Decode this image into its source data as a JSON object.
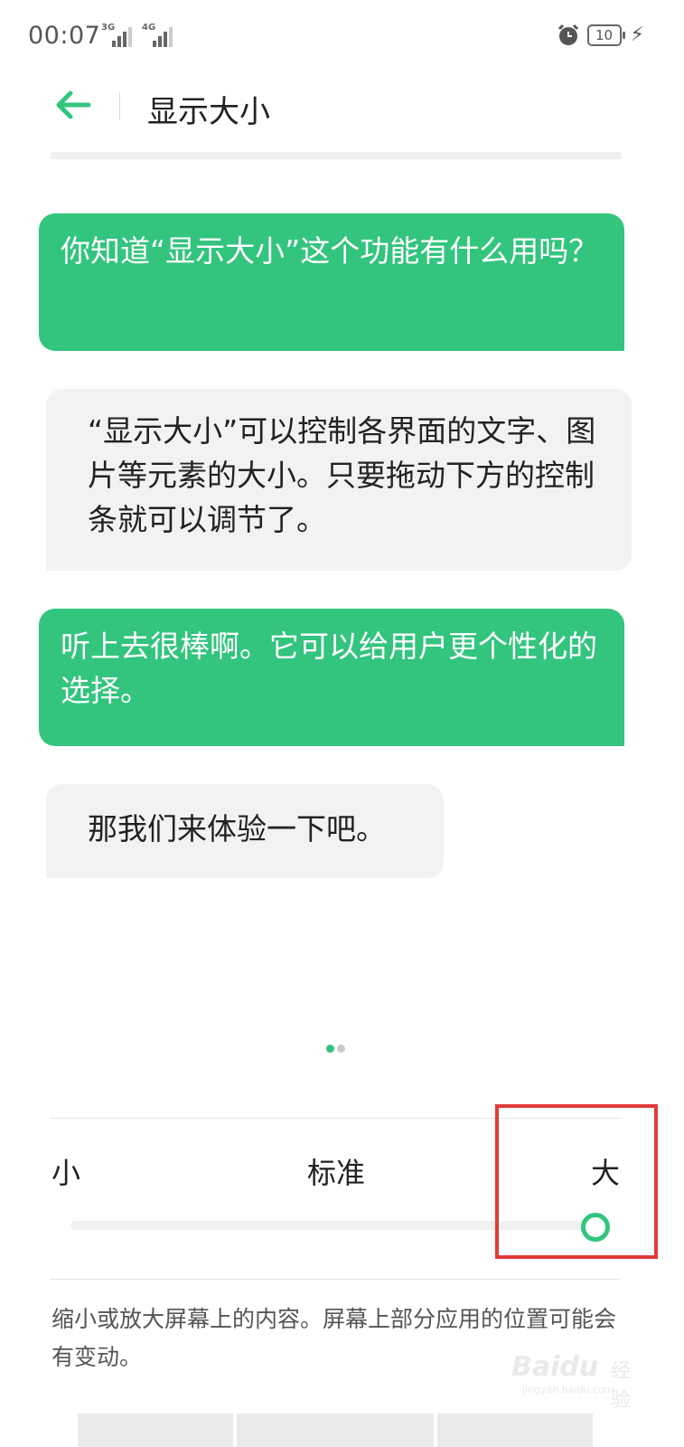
{
  "status_bar": {
    "time": "00:07",
    "signal_1_type": "3G",
    "signal_2_type": "4G",
    "battery_level": "10",
    "icons": [
      "alarm-icon",
      "battery-icon",
      "charging-icon"
    ]
  },
  "header": {
    "title": "显示大小",
    "back_icon": "back-arrow-icon"
  },
  "chat": {
    "bubbles": [
      {
        "side": "right",
        "style": "green",
        "text": "你知道“显示大小”这个功能有什么用吗？"
      },
      {
        "side": "left",
        "style": "gray",
        "text": "“显示大小”可以控制各界面的文字、图片等元素的大小。只要拖动下方的控制条就可以调节了。"
      },
      {
        "side": "right",
        "style": "green",
        "text": "听上去很棒啊。它可以给用户更个性化的选择。"
      },
      {
        "side": "left",
        "style": "gray",
        "text": "那我们来体验一下吧。"
      }
    ]
  },
  "pager": {
    "total": 2,
    "active_index": 0
  },
  "size_control": {
    "labels": {
      "small": "小",
      "standard": "标准",
      "large": "大"
    },
    "current": "大",
    "level_fraction": 1.0
  },
  "description": "缩小或放大屏幕上的内容。屏幕上部分应用的位置可能会有变动。",
  "watermark": {
    "brand": "Baidu",
    "cn": "经验",
    "url": "jingyan.baidu.com"
  },
  "colors": {
    "accent": "#33c47e",
    "highlight": "#e03b3b",
    "gray_bubble": "#f2f2f2"
  }
}
